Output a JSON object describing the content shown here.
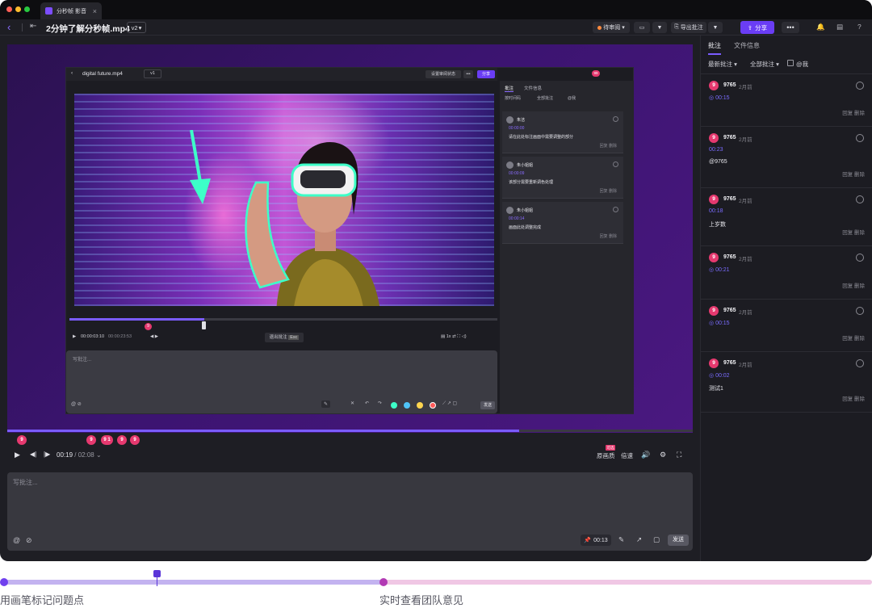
{
  "window": {
    "tab_label": "分秒帧 影音",
    "tab_close": "×"
  },
  "toolbar": {
    "back_icon": "chevron-left-icon",
    "title": "2分钟了解分秒帧.mp4",
    "version": "v2",
    "status_label": "待审阅",
    "export_label": "导出批注",
    "share_label": "分享",
    "more_label": "•••"
  },
  "inner_app": {
    "title": "digital future.mp4",
    "version": "v1",
    "status_btn": "设置审阅状态",
    "share_btn": "分享",
    "badge": "99",
    "timecode": "00:00:03:10",
    "duration": "00:00:23:53",
    "exit_annotation": "退出批注",
    "esc": "Esc",
    "comment_placeholder": "写批注...",
    "send": "发送",
    "panel_tabs": [
      "批注",
      "文件信息"
    ],
    "panel_filters": [
      "按时间码",
      "全部批注",
      "@我"
    ],
    "panel_cards": [
      {
        "name": "朱洁",
        "time": "00:00:00",
        "text": "请在此处标注画面中需要调整的部分",
        "footer": "回复 删除"
      },
      {
        "name": "朱小姐姐",
        "time": "00:00:09",
        "text": "该部分需要重新调色处理",
        "footer": "回复 删除"
      },
      {
        "name": "朱小姐姐",
        "time": "00:00:14",
        "text": "画面此处调整完成",
        "footer": "回复 删除"
      }
    ],
    "marker": "9"
  },
  "player": {
    "current_time": "00:19",
    "total_time": "02:08",
    "markers": [
      "9",
      "9",
      "9 1",
      "9",
      "9"
    ],
    "quality_label": "原画质",
    "quality_badge": "可选",
    "speed_label": "倍速"
  },
  "comment_box": {
    "placeholder": "写批注...",
    "timestamp": "00:13",
    "send_label": "发送"
  },
  "sidebar": {
    "tabs": [
      "批注",
      "文件信息"
    ],
    "filter_sort": "最新批注",
    "filter_scope": "全部批注",
    "filter_mine": "@我",
    "comments": [
      {
        "avatar": "9",
        "user": "9765",
        "ago": "2月前",
        "timestamp": "00:15",
        "message": "",
        "actions": "回复 删除"
      },
      {
        "avatar": "9",
        "user": "9765",
        "ago": "2月前",
        "timestamp": "00:23",
        "message": "@9765",
        "actions": "回复 删除"
      },
      {
        "avatar": "9",
        "user": "9765",
        "ago": "2月前",
        "timestamp": "00:18",
        "message": "上岁数",
        "actions": "回复 删除"
      },
      {
        "avatar": "9",
        "user": "9765",
        "ago": "2月前",
        "timestamp": "00:21",
        "message": "",
        "actions": "回复 删除"
      },
      {
        "avatar": "9",
        "user": "9765",
        "ago": "2月前",
        "timestamp": "00:15",
        "message": "",
        "actions": "回复 删除"
      },
      {
        "avatar": "9",
        "user": "9765",
        "ago": "2月前",
        "timestamp": "00:02",
        "message": "测试1",
        "actions": "回复 删除"
      }
    ]
  },
  "timeline": {
    "label_left": "用画笔标记问题点",
    "label_right": "实时查看团队意见"
  },
  "colors": {
    "accent": "#7a5cff",
    "share_button": "#6a3df5",
    "marker": "#e6396f",
    "timeline_left": "#c3b3f0",
    "timeline_right": "#f0c7e4"
  }
}
